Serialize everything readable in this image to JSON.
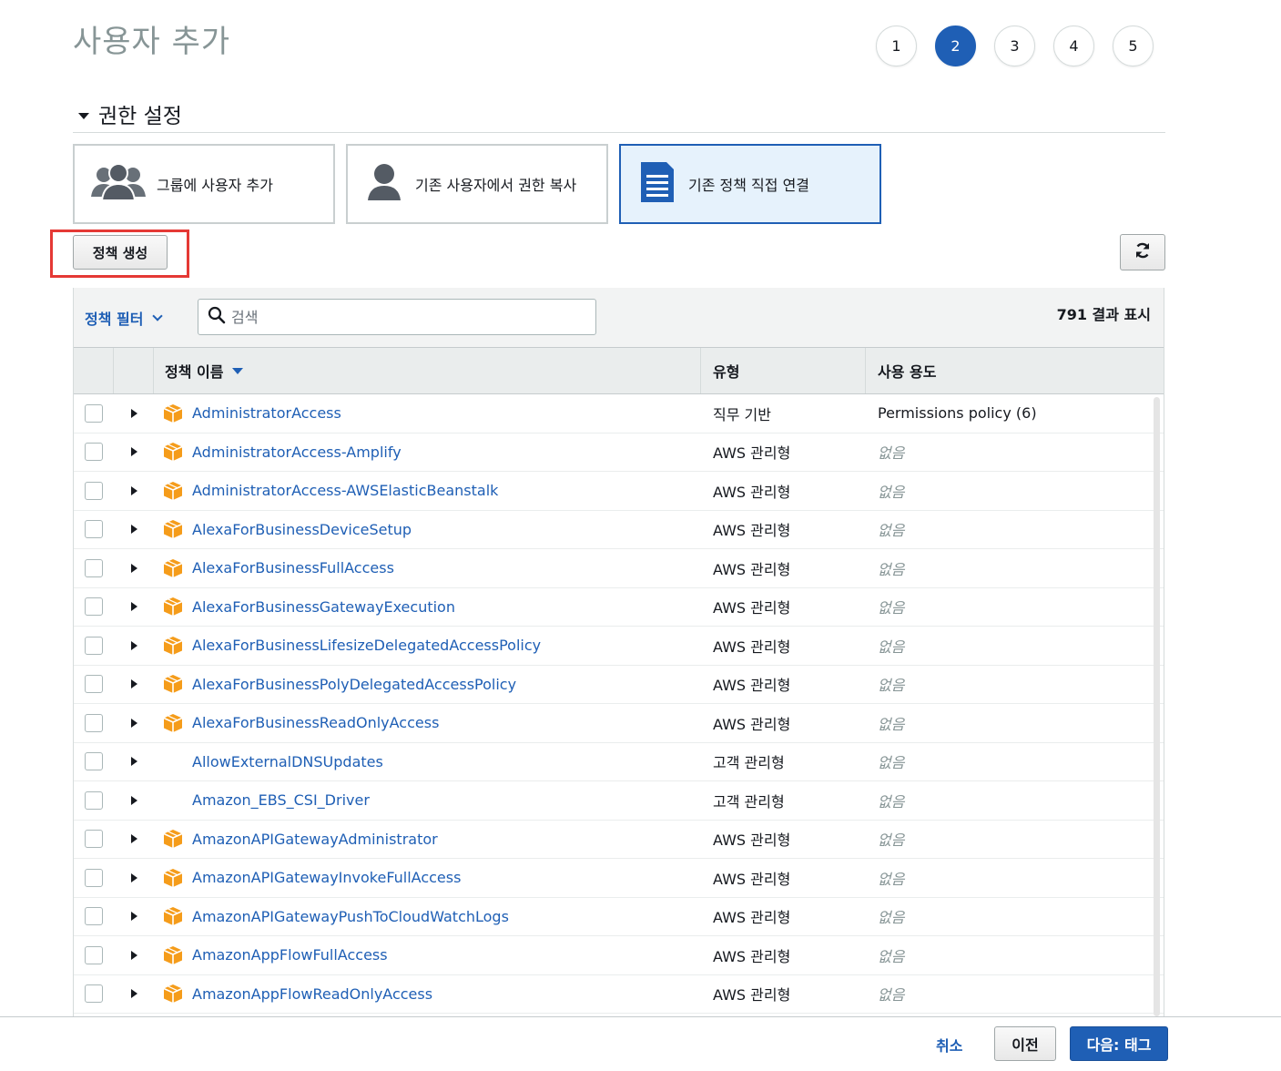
{
  "page": {
    "title": "사용자 추가"
  },
  "steps": [
    "1",
    "2",
    "3",
    "4",
    "5"
  ],
  "active_step": "2",
  "section": {
    "title": "권한 설정"
  },
  "options": [
    {
      "label": "그룹에 사용자 추가",
      "icon": "group-icon",
      "selected": false
    },
    {
      "label": "기존 사용자에서 권한 복사",
      "icon": "user-icon",
      "selected": false
    },
    {
      "label": "기존 정책 직접 연결",
      "icon": "document-icon",
      "selected": true
    }
  ],
  "create_policy_label": "정책 생성",
  "toolbar": {
    "filter_label": "정책 필터",
    "search_placeholder": "검색",
    "results_text": "791 결과 표시"
  },
  "columns": {
    "name": "정책 이름",
    "type": "유형",
    "usage": "사용 용도"
  },
  "rows": [
    {
      "name": "AdministratorAccess",
      "type": "직무 기반",
      "usage": "Permissions policy (6)",
      "aws_icon": true,
      "none": false
    },
    {
      "name": "AdministratorAccess-Amplify",
      "type": "AWS 관리형",
      "usage": "없음",
      "aws_icon": true,
      "none": true
    },
    {
      "name": "AdministratorAccess-AWSElasticBeanstalk",
      "type": "AWS 관리형",
      "usage": "없음",
      "aws_icon": true,
      "none": true
    },
    {
      "name": "AlexaForBusinessDeviceSetup",
      "type": "AWS 관리형",
      "usage": "없음",
      "aws_icon": true,
      "none": true
    },
    {
      "name": "AlexaForBusinessFullAccess",
      "type": "AWS 관리형",
      "usage": "없음",
      "aws_icon": true,
      "none": true
    },
    {
      "name": "AlexaForBusinessGatewayExecution",
      "type": "AWS 관리형",
      "usage": "없음",
      "aws_icon": true,
      "none": true
    },
    {
      "name": "AlexaForBusinessLifesizeDelegatedAccessPolicy",
      "type": "AWS 관리형",
      "usage": "없음",
      "aws_icon": true,
      "none": true
    },
    {
      "name": "AlexaForBusinessPolyDelegatedAccessPolicy",
      "type": "AWS 관리형",
      "usage": "없음",
      "aws_icon": true,
      "none": true
    },
    {
      "name": "AlexaForBusinessReadOnlyAccess",
      "type": "AWS 관리형",
      "usage": "없음",
      "aws_icon": true,
      "none": true
    },
    {
      "name": "AllowExternalDNSUpdates",
      "type": "고객 관리형",
      "usage": "없음",
      "aws_icon": false,
      "none": true
    },
    {
      "name": "Amazon_EBS_CSI_Driver",
      "type": "고객 관리형",
      "usage": "없음",
      "aws_icon": false,
      "none": true
    },
    {
      "name": "AmazonAPIGatewayAdministrator",
      "type": "AWS 관리형",
      "usage": "없음",
      "aws_icon": true,
      "none": true
    },
    {
      "name": "AmazonAPIGatewayInvokeFullAccess",
      "type": "AWS 관리형",
      "usage": "없음",
      "aws_icon": true,
      "none": true
    },
    {
      "name": "AmazonAPIGatewayPushToCloudWatchLogs",
      "type": "AWS 관리형",
      "usage": "없음",
      "aws_icon": true,
      "none": true
    },
    {
      "name": "AmazonAppFlowFullAccess",
      "type": "AWS 관리형",
      "usage": "없음",
      "aws_icon": true,
      "none": true
    },
    {
      "name": "AmazonAppFlowReadOnlyAccess",
      "type": "AWS 관리형",
      "usage": "없음",
      "aws_icon": true,
      "none": true
    }
  ],
  "footer": {
    "cancel_label": "취소",
    "prev_label": "이전",
    "next_label": "다음: 태그"
  },
  "colors": {
    "accent": "#1f5fb5",
    "aws_orange": "#f59c1a",
    "highlight": "#e53935"
  }
}
